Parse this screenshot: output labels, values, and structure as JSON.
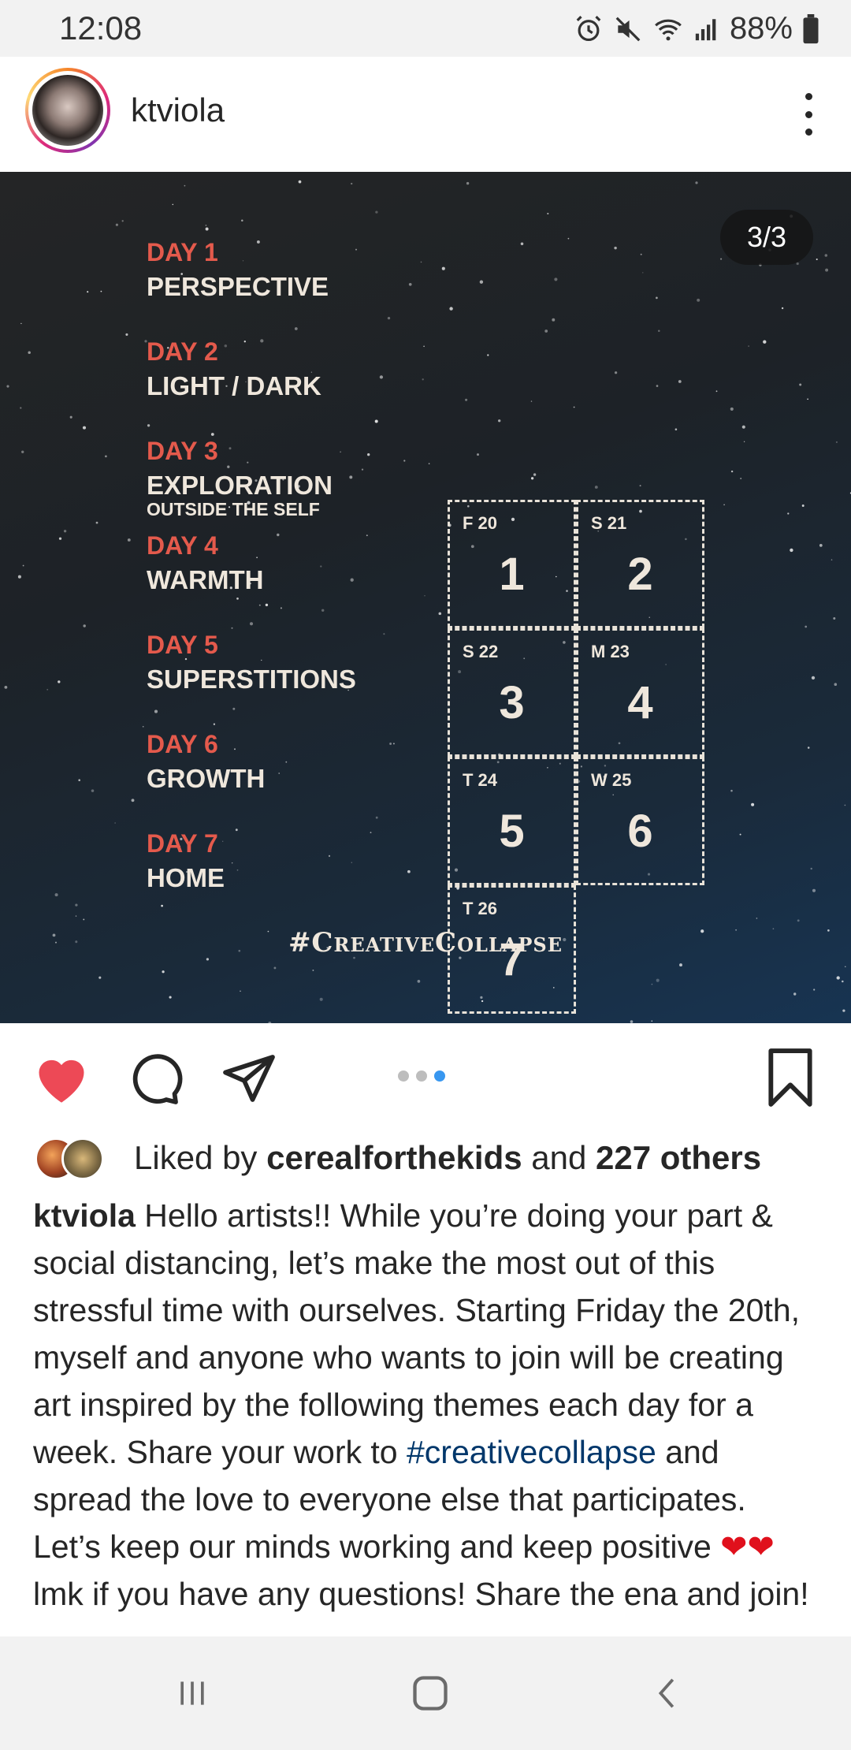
{
  "status_bar": {
    "time": "12:08",
    "battery_percent": "88%",
    "icons": [
      "alarm-icon",
      "mute-icon",
      "wifi-icon",
      "signal-icon",
      "battery-icon"
    ]
  },
  "post": {
    "username": "ktviola",
    "image_counter": "3/3",
    "days": [
      {
        "label": "DAY 1",
        "theme": "PERSPECTIVE"
      },
      {
        "label": "DAY 2",
        "theme": "LIGHT / DARK"
      },
      {
        "label": "DAY 3",
        "theme": "EXPLORATION",
        "subtitle": "OUTSIDE THE SELF"
      },
      {
        "label": "DAY 4",
        "theme": "WARMTH"
      },
      {
        "label": "DAY 5",
        "theme": "SUPERSTITIONS"
      },
      {
        "label": "DAY 6",
        "theme": "GROWTH"
      },
      {
        "label": "DAY 7",
        "theme": "HOME"
      }
    ],
    "calendar": [
      {
        "date": "F 20",
        "num": "1"
      },
      {
        "date": "S 21",
        "num": "2"
      },
      {
        "date": "S 22",
        "num": "3"
      },
      {
        "date": "M 23",
        "num": "4"
      },
      {
        "date": "T 24",
        "num": "5"
      },
      {
        "date": "W 25",
        "num": "6"
      },
      {
        "date": "T 26",
        "num": "7"
      }
    ],
    "image_hashtag": "#CreativeCollapse",
    "carousel": {
      "total": 3,
      "active": 3
    }
  },
  "actions": {
    "liked": true,
    "like_color": "#ed4956",
    "accent_color": "#3897f0"
  },
  "likes": {
    "prefix": "Liked by",
    "first_liker": "cerealforthekids",
    "middle": "and",
    "others": "227 others"
  },
  "caption": {
    "user": "ktviola",
    "text_1": "Hello artists!! While you’re doing your part & social distancing, let’s make the most out of this stressful time with ourselves. Starting Friday the 20th, myself and anyone who wants to join will be creating art inspired by the following themes each day for a week. Share your work to",
    "hashtag": "#creativecollapse",
    "text_2": "and spread the love to everyone else that participates. Let’s keep our minds working and keep positive",
    "hearts": "❤❤",
    "text_3": "lmk if you have any questions! Share the ena and join!"
  },
  "nav": {
    "icons": [
      "recent-apps-icon",
      "home-icon",
      "back-icon"
    ]
  }
}
